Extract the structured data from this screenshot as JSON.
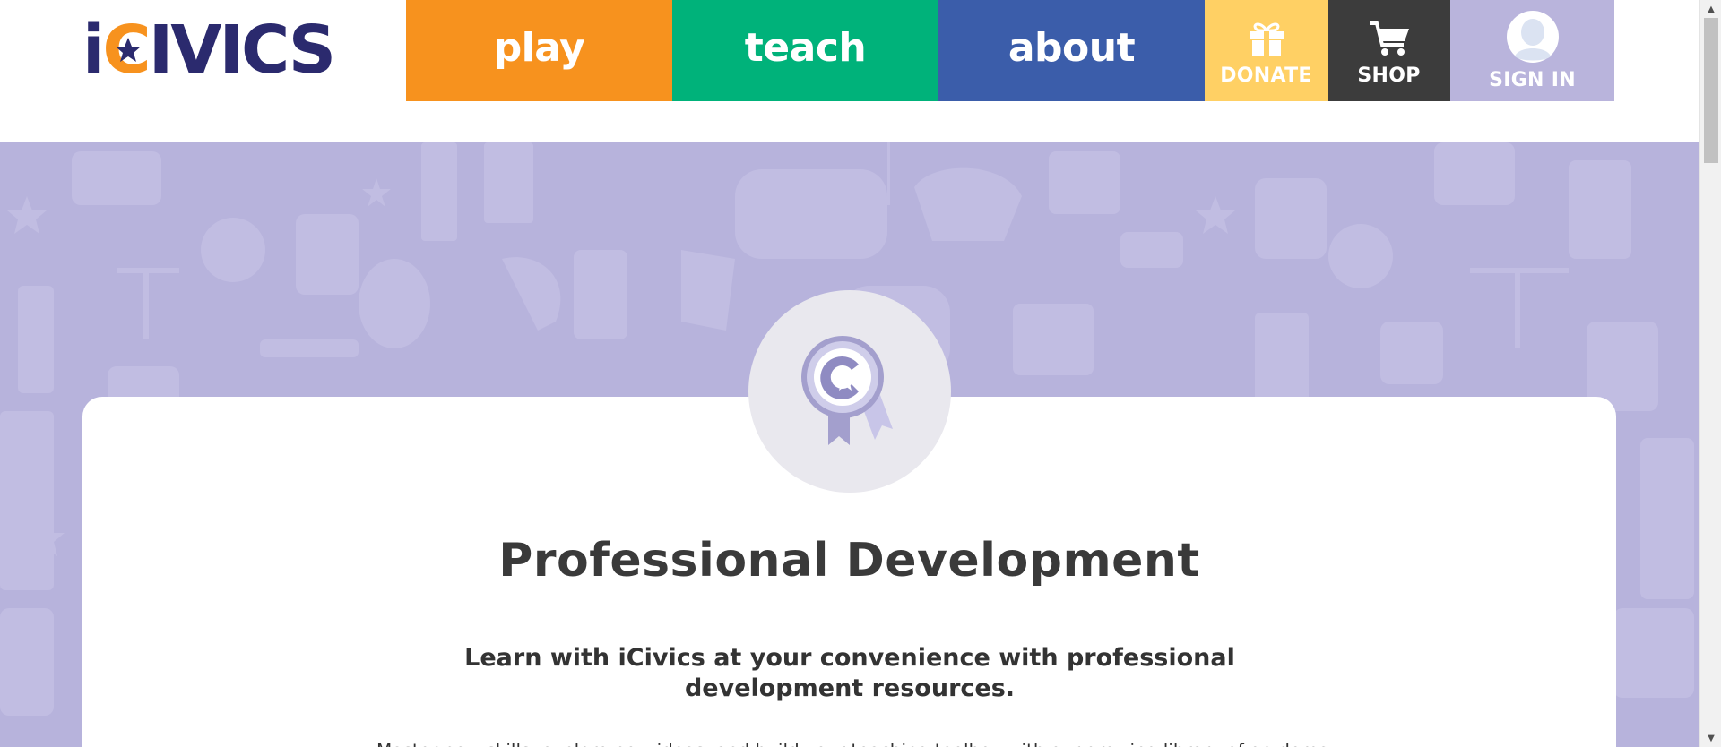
{
  "header": {
    "logo_text_i": "i",
    "logo_text_c": "C",
    "logo_text_rest": "IVICS",
    "nav": {
      "play": "play",
      "teach": "teach",
      "about": "about",
      "donate": "DONATE",
      "shop": "SHOP",
      "sign_in": "SIGN IN"
    }
  },
  "main": {
    "title": "Professional Development",
    "subtitle": "Learn with iCivics at your convenience with professional development resources.",
    "body": "Master new skills, explore new ideas, and build your teaching toolbox with our growing library of on-demand"
  },
  "icons": [
    "icivics-logo",
    "gift-icon",
    "cart-icon",
    "user-avatar-icon",
    "award-ribbon-icon"
  ],
  "colors": {
    "play": "#f7921e",
    "teach": "#00b27a",
    "about": "#3b5daa",
    "donate": "#ffd064",
    "shop": "#3c3c3c",
    "sign_in": "#b9b4dc",
    "hero": "#b7b3dc",
    "brand_navy": "#2b2a6e"
  }
}
